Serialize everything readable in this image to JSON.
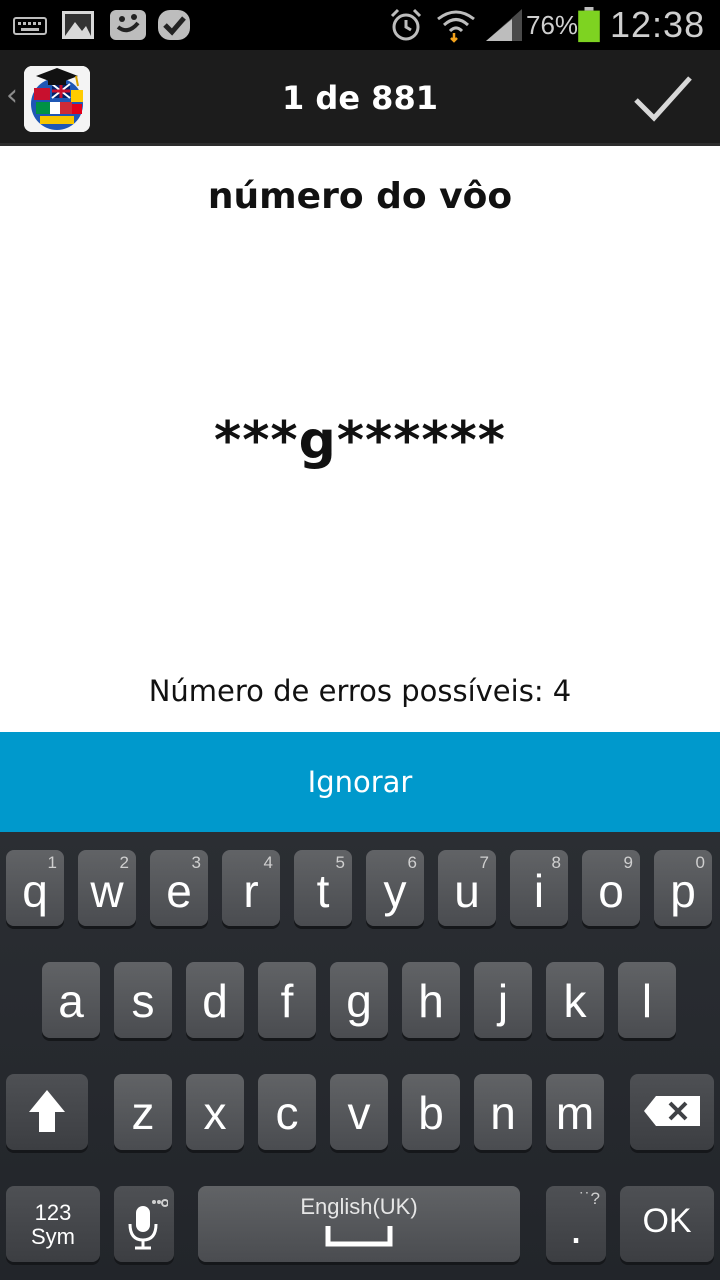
{
  "status_bar": {
    "battery_percent": "76%",
    "time": "12:38",
    "icons": [
      "keyboard-icon",
      "image-icon",
      "chat-icon",
      "check-task-icon",
      "alarm-icon",
      "wifi-icon",
      "signal-icon",
      "battery-icon"
    ]
  },
  "action_bar": {
    "back_label": "‹",
    "title": "1 de 881",
    "confirm_icon": "checkmark-icon"
  },
  "content": {
    "word": "número do vôo",
    "masked_answer": "***g******",
    "errors_text": "Número de erros possíveis: 4"
  },
  "ignore_button": {
    "label": "Ignorar"
  },
  "keyboard": {
    "row1": [
      {
        "char": "q",
        "num": "1"
      },
      {
        "char": "w",
        "num": "2"
      },
      {
        "char": "e",
        "num": "3"
      },
      {
        "char": "r",
        "num": "4"
      },
      {
        "char": "t",
        "num": "5"
      },
      {
        "char": "y",
        "num": "6"
      },
      {
        "char": "u",
        "num": "7"
      },
      {
        "char": "i",
        "num": "8"
      },
      {
        "char": "o",
        "num": "9"
      },
      {
        "char": "p",
        "num": "0"
      }
    ],
    "row2": [
      "a",
      "s",
      "d",
      "f",
      "g",
      "h",
      "j",
      "k",
      "l"
    ],
    "row3": [
      "z",
      "x",
      "c",
      "v",
      "b",
      "n",
      "m"
    ],
    "sym_line1": "123",
    "sym_line2": "Sym",
    "space_label": "English(UK)",
    "period_key": ".",
    "period_hint": "˙˙?",
    "ok_label": "OK",
    "colors": {
      "key_top": "#616366",
      "key_bottom": "#4a4c50",
      "accent": "#0099cc"
    }
  }
}
